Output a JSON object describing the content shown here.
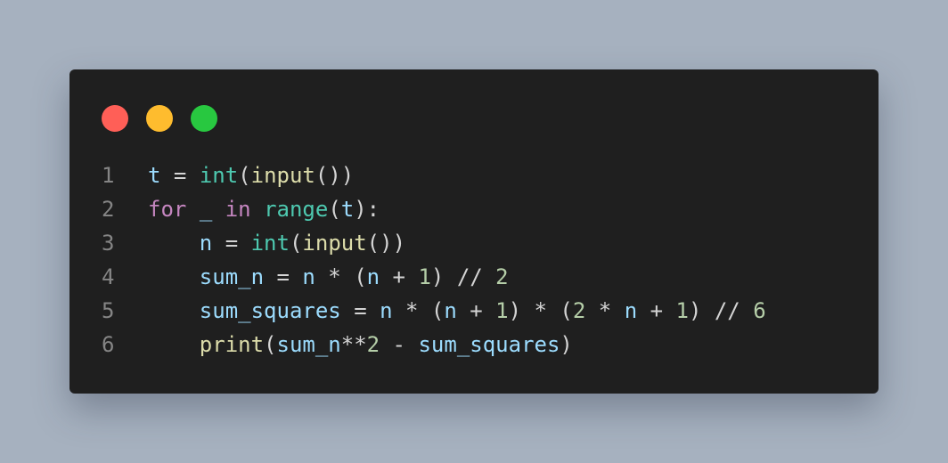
{
  "window": {
    "controls": [
      "close",
      "minimize",
      "maximize"
    ],
    "colors": {
      "background": "#1f1f1f",
      "close": "#ff5f57",
      "minimize": "#febc2e",
      "maximize": "#28c840"
    }
  },
  "code": {
    "lines": [
      {
        "number": "1",
        "tokens": [
          {
            "t": "t",
            "c": "var"
          },
          {
            "t": " = ",
            "c": "op"
          },
          {
            "t": "int",
            "c": "builtin"
          },
          {
            "t": "(",
            "c": "op"
          },
          {
            "t": "input",
            "c": "fn"
          },
          {
            "t": "())",
            "c": "op"
          }
        ]
      },
      {
        "number": "2",
        "tokens": [
          {
            "t": "for",
            "c": "kw"
          },
          {
            "t": " ",
            "c": "op"
          },
          {
            "t": "_",
            "c": "var"
          },
          {
            "t": " ",
            "c": "op"
          },
          {
            "t": "in",
            "c": "kw"
          },
          {
            "t": " ",
            "c": "op"
          },
          {
            "t": "range",
            "c": "builtin"
          },
          {
            "t": "(",
            "c": "op"
          },
          {
            "t": "t",
            "c": "var"
          },
          {
            "t": "):",
            "c": "op"
          }
        ]
      },
      {
        "number": "3",
        "tokens": [
          {
            "t": "    ",
            "c": "op"
          },
          {
            "t": "n",
            "c": "var"
          },
          {
            "t": " = ",
            "c": "op"
          },
          {
            "t": "int",
            "c": "builtin"
          },
          {
            "t": "(",
            "c": "op"
          },
          {
            "t": "input",
            "c": "fn"
          },
          {
            "t": "())",
            "c": "op"
          }
        ]
      },
      {
        "number": "4",
        "tokens": [
          {
            "t": "    ",
            "c": "op"
          },
          {
            "t": "sum_n",
            "c": "var"
          },
          {
            "t": " = ",
            "c": "op"
          },
          {
            "t": "n",
            "c": "var"
          },
          {
            "t": " * (",
            "c": "op"
          },
          {
            "t": "n",
            "c": "var"
          },
          {
            "t": " + ",
            "c": "op"
          },
          {
            "t": "1",
            "c": "num"
          },
          {
            "t": ") // ",
            "c": "op"
          },
          {
            "t": "2",
            "c": "num"
          }
        ]
      },
      {
        "number": "5",
        "tokens": [
          {
            "t": "    ",
            "c": "op"
          },
          {
            "t": "sum_squares",
            "c": "var"
          },
          {
            "t": " = ",
            "c": "op"
          },
          {
            "t": "n",
            "c": "var"
          },
          {
            "t": " * (",
            "c": "op"
          },
          {
            "t": "n",
            "c": "var"
          },
          {
            "t": " + ",
            "c": "op"
          },
          {
            "t": "1",
            "c": "num"
          },
          {
            "t": ") * (",
            "c": "op"
          },
          {
            "t": "2",
            "c": "num"
          },
          {
            "t": " * ",
            "c": "op"
          },
          {
            "t": "n",
            "c": "var"
          },
          {
            "t": " + ",
            "c": "op"
          },
          {
            "t": "1",
            "c": "num"
          },
          {
            "t": ") // ",
            "c": "op"
          },
          {
            "t": "6",
            "c": "num"
          }
        ]
      },
      {
        "number": "6",
        "tokens": [
          {
            "t": "    ",
            "c": "op"
          },
          {
            "t": "print",
            "c": "fn"
          },
          {
            "t": "(",
            "c": "op"
          },
          {
            "t": "sum_n",
            "c": "var"
          },
          {
            "t": "**",
            "c": "op"
          },
          {
            "t": "2",
            "c": "num"
          },
          {
            "t": " - ",
            "c": "op"
          },
          {
            "t": "sum_squares",
            "c": "var"
          },
          {
            "t": ")",
            "c": "op"
          }
        ]
      }
    ]
  }
}
